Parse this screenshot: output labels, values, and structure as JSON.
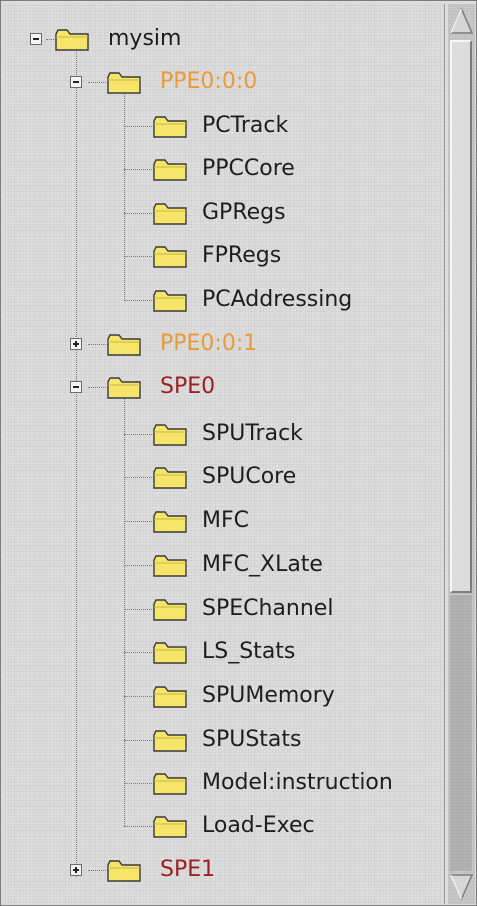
{
  "tree": {
    "root": {
      "label": "mysim",
      "icon": "folder-icon",
      "state": "expanded"
    },
    "items": [
      {
        "label": "PPE0:0:0",
        "color": "#e99a36",
        "state": "expanded",
        "children": [
          "PCTrack",
          "PPCCore",
          "GPRegs",
          "FPRegs",
          "PCAddressing"
        ]
      },
      {
        "label": "PPE0:0:1",
        "color": "#e99a36",
        "state": "collapsed",
        "children": []
      },
      {
        "label": "SPE0",
        "color": "#9c1e1e",
        "state": "expanded",
        "children": [
          "SPUTrack",
          "SPUCore",
          "MFC",
          "MFC_XLate",
          "SPEChannel",
          "LS_Stats",
          "SPUMemory",
          "SPUStats",
          "Model:instruction",
          "Load-Exec"
        ]
      },
      {
        "label": "SPE1",
        "color": "#9c1e1e",
        "state": "collapsed",
        "children": []
      }
    ]
  },
  "scrollbar": {
    "up_icon": "scroll-up-arrow-icon",
    "down_icon": "scroll-down-arrow-icon",
    "visible_fraction": 0.66
  },
  "colors": {
    "folder_fill": "#f5e56a",
    "folder_stroke": "#3a3a3a",
    "background": "#dedede"
  }
}
